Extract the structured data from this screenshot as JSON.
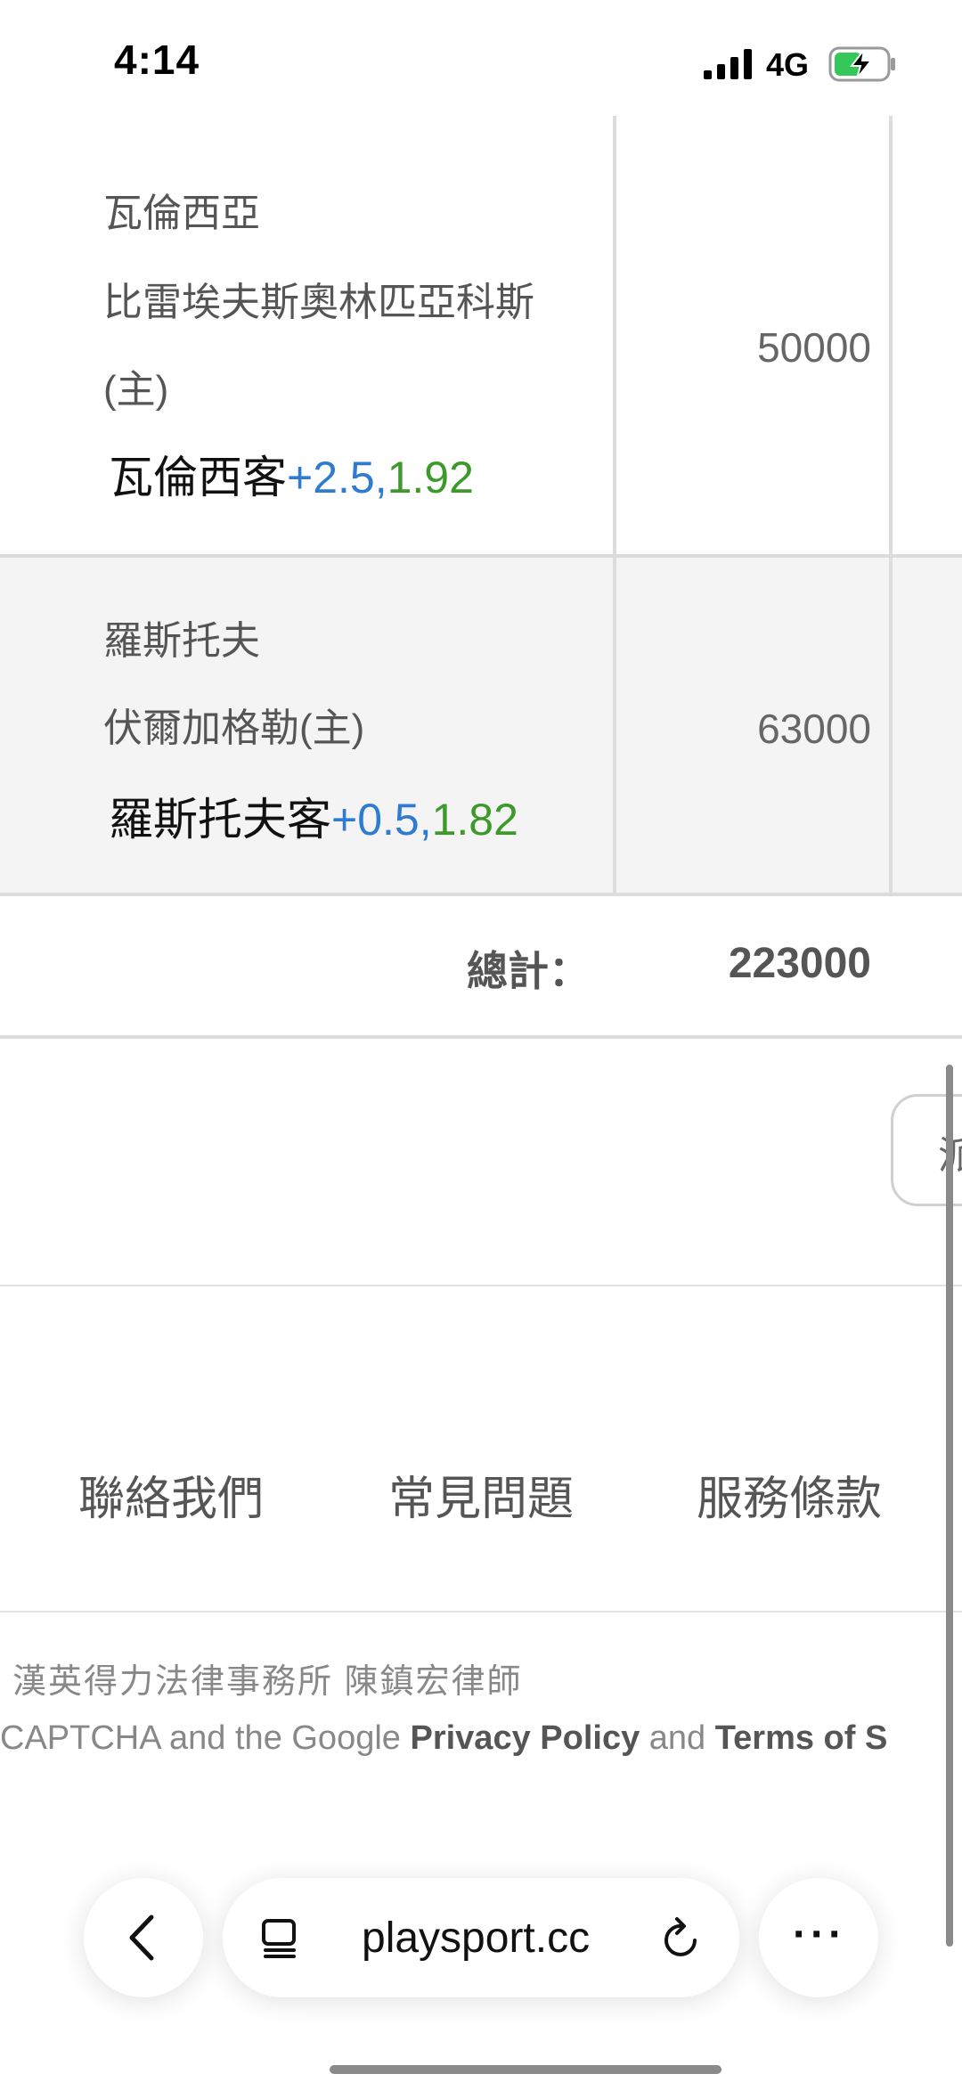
{
  "status_bar": {
    "time": "4:14",
    "network": "4G"
  },
  "bets": [
    {
      "away_team": "瓦倫西亞",
      "home_team": "比雷埃夫斯奧林匹亞科斯",
      "home_suffix": "(主)",
      "pick_team": "瓦倫西客",
      "pick_handicap": "+2.5,",
      "pick_odds": "1.92",
      "amount": "50000"
    },
    {
      "away_team": "羅斯托夫",
      "home_team": "伏爾加格勒(主)",
      "pick_team": "羅斯托夫客",
      "pick_handicap": "+0.5,",
      "pick_odds": "1.82",
      "amount": "63000"
    }
  ],
  "total": {
    "label": "總計：",
    "value": "223000"
  },
  "partial_button": {
    "label": "派"
  },
  "footer": {
    "links": [
      "聯絡我們",
      "常見問題",
      "服務條款"
    ],
    "firm": "漢英得力法律事務所 陳鎮宏律師",
    "recaptcha": {
      "prefix": "CAPTCHA and the Google ",
      "privacy": "Privacy Policy",
      "and": " and ",
      "terms": "Terms of S"
    }
  },
  "browser": {
    "url": "playsport.cc",
    "more": "···"
  },
  "colors": {
    "handicap": "#2f7bd0",
    "odds": "#3d9a2a",
    "row_alt": "#f4f4f4"
  }
}
